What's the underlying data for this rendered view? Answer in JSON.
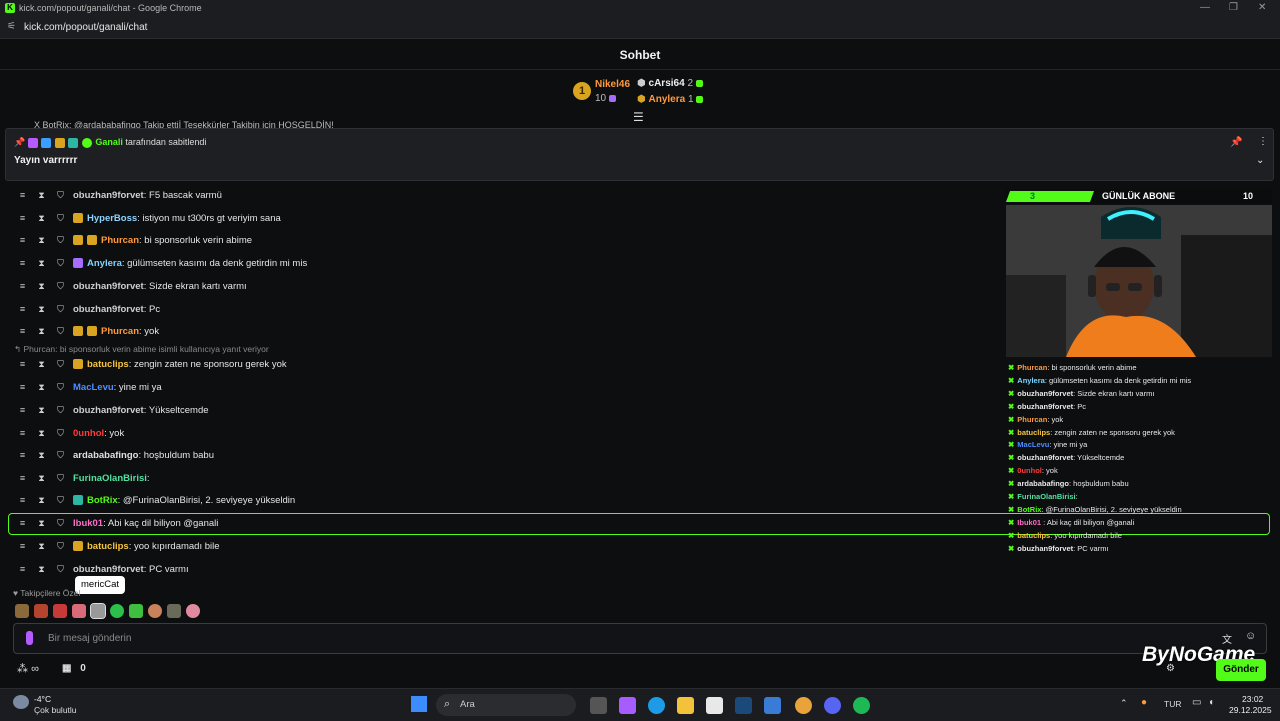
{
  "window": {
    "title": "kick.com/popout/ganali/chat - Google Chrome",
    "url": "kick.com/popout/ganali/chat"
  },
  "header": {
    "title": "Sohbet"
  },
  "leaderboard": {
    "first": {
      "rank": "1",
      "name": "Nikel46",
      "count": "10"
    },
    "second": {
      "name": "cArsi64",
      "count": "2"
    },
    "third": {
      "name": "Anylera",
      "count": "1"
    }
  },
  "peek_text": "BotRix: @ardababafingo Takip ettiİ Teşekkürler Takibin için HOŞGELDİN!",
  "peek_prefix": "X",
  "pinned": {
    "by_user": "Ganali",
    "by_suffix": "tarafından sabitlendi",
    "message": "Yayın varrrrrr"
  },
  "messages": [
    {
      "user": "obuzhan9forvet",
      "text": ": F5 bascak varmü",
      "color": "#cfcfcf"
    },
    {
      "user": "HyperBoss",
      "text": ": istiyon mu t300rs gt veriyim sana",
      "color": "#8fd3ff"
    },
    {
      "user": "Phurcan",
      "text": ": bi sponsorluk verin abime",
      "color": "#ff9a3c"
    },
    {
      "user": "Anylera",
      "text": ": gülümseten kasımı da denk getirdin mi mis",
      "color": "#7dd6ff"
    },
    {
      "user": "obuzhan9forvet",
      "text": ": Sizde ekran kartı varmı",
      "color": "#cfcfcf"
    },
    {
      "user": "obuzhan9forvet",
      "text": ": Pc",
      "color": "#cfcfcf"
    },
    {
      "user": "Phurcan",
      "text": ": yok",
      "color": "#ff9a3c"
    },
    {
      "user": "batuclips",
      "text": ": zengin zaten ne sponsoru gerek yok",
      "color": "#f5c542"
    },
    {
      "user": "MacLevu",
      "text": ": yine mi ya",
      "color": "#4d8dff"
    },
    {
      "user": "obuzhan9forvet",
      "text": ": Yükseltcemde",
      "color": "#cfcfcf"
    },
    {
      "user": "0unhol",
      "text": ": yok",
      "color": "#ff3b3b"
    },
    {
      "user": "ardababafingo",
      "text": ": hoşbuldum babu",
      "color": "#e0e0e0"
    },
    {
      "user": "FurinaOlanBirisi",
      "text": ":",
      "color": "#53e0a0"
    },
    {
      "user": "BotRix",
      "text": ": @FurinaOlanBirisi, 2. seviyeye yükseldin",
      "color": "#53fc18"
    },
    {
      "user": "Ibuk01",
      "text": ": Abi kaç dil biliyon @ganali",
      "color": "#ff6ec7"
    },
    {
      "user": "batuclips",
      "text": ": yoo kıpırdamadı bile",
      "color": "#f5c542"
    },
    {
      "user": "obuzhan9forvet",
      "text": ": PC varmı",
      "color": "#cfcfcf"
    }
  ],
  "reply_note": "Phurcan: bi sponsorluk verin abime isimli kullanıcıya yanıt veriyor",
  "overlay": {
    "sub_current": "3",
    "sub_label": "GÜNLÜK ABONE",
    "sub_goal": "10",
    "lines": [
      {
        "user": "Phurcan",
        "text": ": bi sponsorluk verin abime",
        "color": "#ff9a3c"
      },
      {
        "user": "Anylera",
        "text": ": gülümseten kasımı da denk getirdin mi mis",
        "color": "#7dd6ff"
      },
      {
        "user": "obuzhan9forvet",
        "text": ": Sizde ekran kartı varmı",
        "color": "#e8e8e8"
      },
      {
        "user": "obuzhan9forvet",
        "text": ": Pc",
        "color": "#e8e8e8"
      },
      {
        "user": "Phurcan",
        "text": ": yok",
        "color": "#ff9a3c"
      },
      {
        "user": "batuclips",
        "text": ": zengin zaten ne sponsoru gerek yok",
        "color": "#f5c542"
      },
      {
        "user": "MacLevu",
        "text": ": yine mi ya",
        "color": "#4d8dff"
      },
      {
        "user": "obuzhan9forvet",
        "text": ": Yükseltcemde",
        "color": "#e8e8e8"
      },
      {
        "user": "0unhol",
        "text": ": yok",
        "color": "#ff3b3b"
      },
      {
        "user": "ardababafingo",
        "text": ": hoşbuldum babu",
        "color": "#e8e8e8"
      },
      {
        "user": "FurinaOlanBirisi",
        "text": ":",
        "color": "#53e0a0"
      },
      {
        "user": "BotRix",
        "text": ": @FurinaOlanBirisi, 2. seviyeye yükseldin",
        "color": "#53fc18"
      },
      {
        "user": "Ibuk01",
        "text": " : Abi kaç dil biliyon @ganali",
        "color": "#ff6ec7"
      },
      {
        "user": "batuclips",
        "text": ": yoo kıpırdamadı bile",
        "color": "#f5c542"
      },
      {
        "user": "obuzhan9forvet",
        "text": ": PC varmı",
        "color": "#e8e8e8"
      }
    ]
  },
  "emote_tooltip": "mericCat",
  "emote_section": "Takipçilere Özel",
  "input": {
    "placeholder": "Bir mesaj gönderin",
    "send_label": "Gönder"
  },
  "footer": {
    "viewers": "∞",
    "points": "0"
  },
  "watermark": "ByNoGame",
  "taskbar": {
    "weather_temp": "-4°C",
    "weather_desc": "Çok bulutlu",
    "search": "Ara",
    "lang": "TUR",
    "time": "23:02",
    "date": "29.12.2025"
  },
  "colors": {
    "accent": "#53fc18",
    "bg": "#0d0e10"
  }
}
